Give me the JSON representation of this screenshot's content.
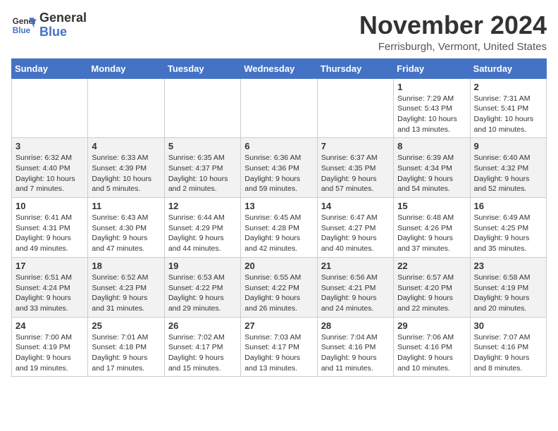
{
  "header": {
    "logo_line1": "General",
    "logo_line2": "Blue",
    "month_title": "November 2024",
    "location": "Ferrisburgh, Vermont, United States"
  },
  "days_of_week": [
    "Sunday",
    "Monday",
    "Tuesday",
    "Wednesday",
    "Thursday",
    "Friday",
    "Saturday"
  ],
  "weeks": [
    [
      {
        "day": "",
        "info": ""
      },
      {
        "day": "",
        "info": ""
      },
      {
        "day": "",
        "info": ""
      },
      {
        "day": "",
        "info": ""
      },
      {
        "day": "",
        "info": ""
      },
      {
        "day": "1",
        "info": "Sunrise: 7:29 AM\nSunset: 5:43 PM\nDaylight: 10 hours and 13 minutes."
      },
      {
        "day": "2",
        "info": "Sunrise: 7:31 AM\nSunset: 5:41 PM\nDaylight: 10 hours and 10 minutes."
      }
    ],
    [
      {
        "day": "3",
        "info": "Sunrise: 6:32 AM\nSunset: 4:40 PM\nDaylight: 10 hours and 7 minutes."
      },
      {
        "day": "4",
        "info": "Sunrise: 6:33 AM\nSunset: 4:39 PM\nDaylight: 10 hours and 5 minutes."
      },
      {
        "day": "5",
        "info": "Sunrise: 6:35 AM\nSunset: 4:37 PM\nDaylight: 10 hours and 2 minutes."
      },
      {
        "day": "6",
        "info": "Sunrise: 6:36 AM\nSunset: 4:36 PM\nDaylight: 9 hours and 59 minutes."
      },
      {
        "day": "7",
        "info": "Sunrise: 6:37 AM\nSunset: 4:35 PM\nDaylight: 9 hours and 57 minutes."
      },
      {
        "day": "8",
        "info": "Sunrise: 6:39 AM\nSunset: 4:34 PM\nDaylight: 9 hours and 54 minutes."
      },
      {
        "day": "9",
        "info": "Sunrise: 6:40 AM\nSunset: 4:32 PM\nDaylight: 9 hours and 52 minutes."
      }
    ],
    [
      {
        "day": "10",
        "info": "Sunrise: 6:41 AM\nSunset: 4:31 PM\nDaylight: 9 hours and 49 minutes."
      },
      {
        "day": "11",
        "info": "Sunrise: 6:43 AM\nSunset: 4:30 PM\nDaylight: 9 hours and 47 minutes."
      },
      {
        "day": "12",
        "info": "Sunrise: 6:44 AM\nSunset: 4:29 PM\nDaylight: 9 hours and 44 minutes."
      },
      {
        "day": "13",
        "info": "Sunrise: 6:45 AM\nSunset: 4:28 PM\nDaylight: 9 hours and 42 minutes."
      },
      {
        "day": "14",
        "info": "Sunrise: 6:47 AM\nSunset: 4:27 PM\nDaylight: 9 hours and 40 minutes."
      },
      {
        "day": "15",
        "info": "Sunrise: 6:48 AM\nSunset: 4:26 PM\nDaylight: 9 hours and 37 minutes."
      },
      {
        "day": "16",
        "info": "Sunrise: 6:49 AM\nSunset: 4:25 PM\nDaylight: 9 hours and 35 minutes."
      }
    ],
    [
      {
        "day": "17",
        "info": "Sunrise: 6:51 AM\nSunset: 4:24 PM\nDaylight: 9 hours and 33 minutes."
      },
      {
        "day": "18",
        "info": "Sunrise: 6:52 AM\nSunset: 4:23 PM\nDaylight: 9 hours and 31 minutes."
      },
      {
        "day": "19",
        "info": "Sunrise: 6:53 AM\nSunset: 4:22 PM\nDaylight: 9 hours and 29 minutes."
      },
      {
        "day": "20",
        "info": "Sunrise: 6:55 AM\nSunset: 4:22 PM\nDaylight: 9 hours and 26 minutes."
      },
      {
        "day": "21",
        "info": "Sunrise: 6:56 AM\nSunset: 4:21 PM\nDaylight: 9 hours and 24 minutes."
      },
      {
        "day": "22",
        "info": "Sunrise: 6:57 AM\nSunset: 4:20 PM\nDaylight: 9 hours and 22 minutes."
      },
      {
        "day": "23",
        "info": "Sunrise: 6:58 AM\nSunset: 4:19 PM\nDaylight: 9 hours and 20 minutes."
      }
    ],
    [
      {
        "day": "24",
        "info": "Sunrise: 7:00 AM\nSunset: 4:19 PM\nDaylight: 9 hours and 19 minutes."
      },
      {
        "day": "25",
        "info": "Sunrise: 7:01 AM\nSunset: 4:18 PM\nDaylight: 9 hours and 17 minutes."
      },
      {
        "day": "26",
        "info": "Sunrise: 7:02 AM\nSunset: 4:17 PM\nDaylight: 9 hours and 15 minutes."
      },
      {
        "day": "27",
        "info": "Sunrise: 7:03 AM\nSunset: 4:17 PM\nDaylight: 9 hours and 13 minutes."
      },
      {
        "day": "28",
        "info": "Sunrise: 7:04 AM\nSunset: 4:16 PM\nDaylight: 9 hours and 11 minutes."
      },
      {
        "day": "29",
        "info": "Sunrise: 7:06 AM\nSunset: 4:16 PM\nDaylight: 9 hours and 10 minutes."
      },
      {
        "day": "30",
        "info": "Sunrise: 7:07 AM\nSunset: 4:16 PM\nDaylight: 9 hours and 8 minutes."
      }
    ]
  ]
}
